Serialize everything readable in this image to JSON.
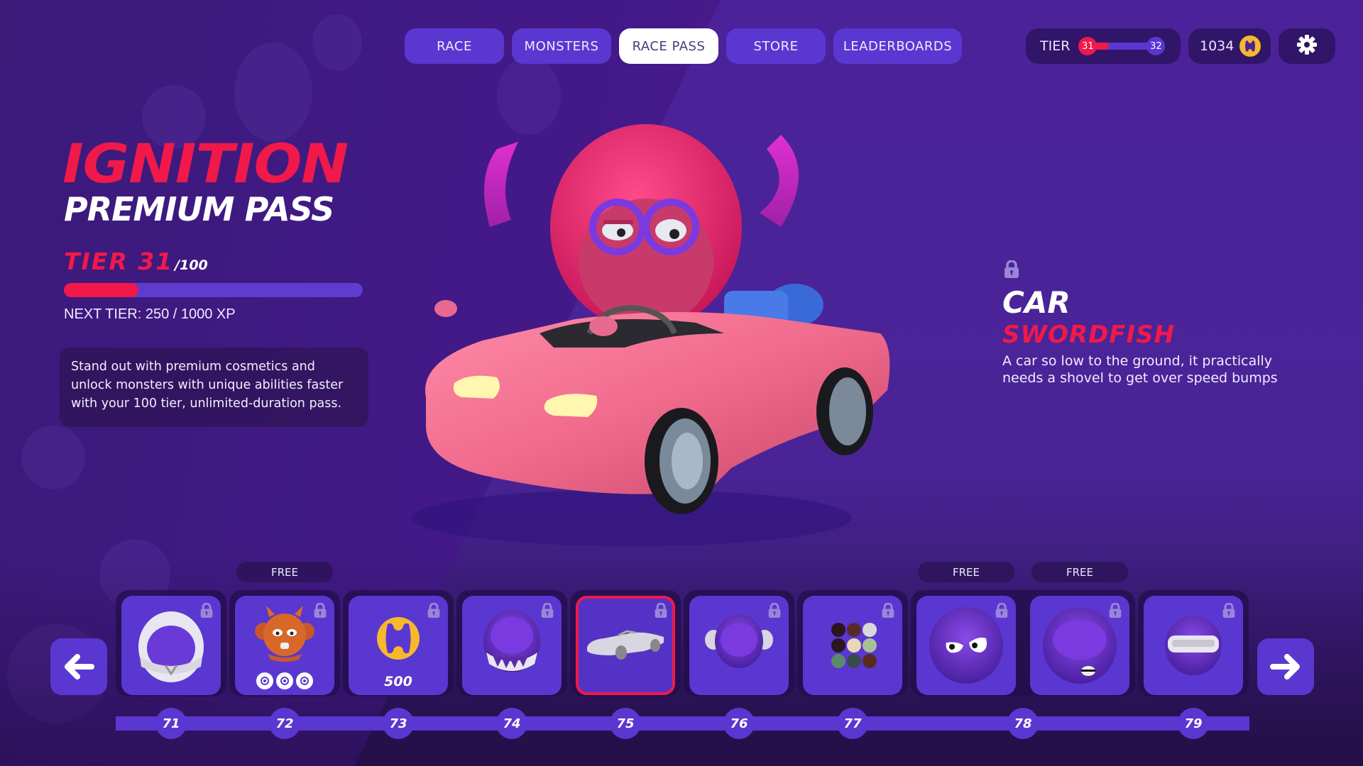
{
  "nav": {
    "tabs": [
      {
        "label": "RACE",
        "active": false
      },
      {
        "label": "MONSTERS",
        "active": false
      },
      {
        "label": "RACE PASS",
        "active": true
      },
      {
        "label": "STORE",
        "active": false
      },
      {
        "label": "LEADERBOARDS",
        "active": false
      }
    ]
  },
  "hud": {
    "tier_label": "TIER",
    "current_tier": "31",
    "next_tier": "32",
    "tier_progress": 0.25,
    "coins": "1034",
    "coin_icon": "monster-coin-icon",
    "settings_icon": "gear-icon"
  },
  "pass": {
    "title": "IGNITION",
    "subtitle": "PREMIUM PASS",
    "tier_text": "TIER 31",
    "tier_max": "/100",
    "progress": 0.25,
    "next_tier_text": "NEXT TIER: 250 / 1000 XP",
    "description": "Stand out with premium cosmetics and unlock monsters with unique abilities faster with your 100 tier, unlimited-duration pass."
  },
  "selected_item": {
    "locked": true,
    "type": "CAR",
    "name": "SWORDFISH",
    "description": "A car so low to the ground, it practically needs a shovel to get over speed bumps"
  },
  "rewards": {
    "free_label": "FREE",
    "items": [
      {
        "tier": "71",
        "kind": "helmet-white",
        "free": false,
        "locked": true
      },
      {
        "tier": "72",
        "kind": "monster",
        "free": true,
        "locked": true
      },
      {
        "tier": "73",
        "kind": "coins",
        "amount": "500",
        "free": false,
        "locked": true
      },
      {
        "tier": "74",
        "kind": "helmet-teeth",
        "free": false,
        "locked": true
      },
      {
        "tier": "75",
        "kind": "car",
        "free": false,
        "locked": true,
        "selected": true
      },
      {
        "tier": "76",
        "kind": "helmet-ears",
        "free": false,
        "locked": true
      },
      {
        "tier": "77",
        "kind": "color-palette",
        "free": false,
        "locked": true
      },
      {
        "tier": "78",
        "kind": "face-eyes",
        "free": true,
        "locked": true
      },
      {
        "tier": "78",
        "kind": "face-mouth",
        "free": true,
        "locked": true
      },
      {
        "tier": "79",
        "kind": "helmet-visor",
        "free": false,
        "locked": true
      }
    ],
    "tier_nodes": [
      "71",
      "72",
      "73",
      "74",
      "75",
      "76",
      "77",
      "78",
      "79"
    ],
    "palette_colors": [
      "#2a1520",
      "#5a2a2a",
      "#d8d8d8",
      "#2a1520",
      "#e8d8b8",
      "#a8c098",
      "#5a8a6a",
      "#3a4a4a",
      "#5a2a22"
    ]
  },
  "colors": {
    "accent": "#f0194a",
    "primary": "#5a37d0",
    "coin": "#f5b82e"
  }
}
